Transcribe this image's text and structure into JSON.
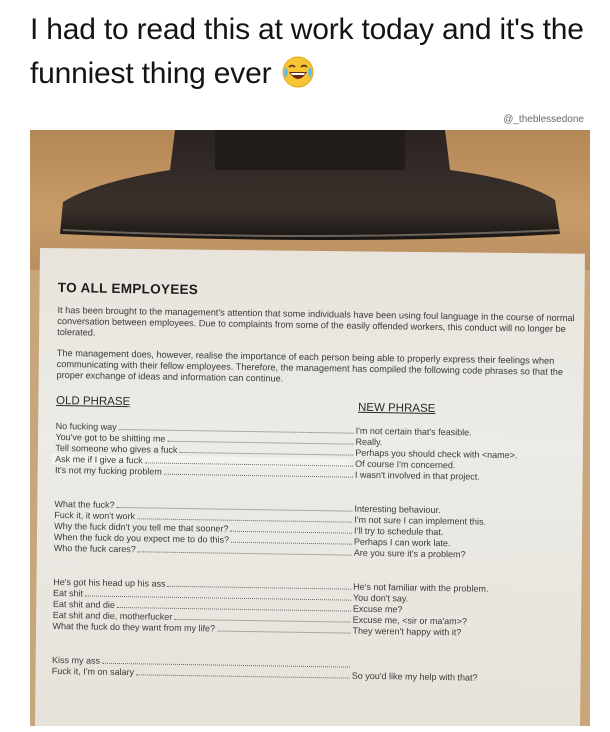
{
  "caption": {
    "text": "I had to read this at work today and it's the funniest thing ever",
    "emoji_icon": "laughing-emoji-icon"
  },
  "watermark": "@_theblessedone",
  "document": {
    "heading": "TO ALL EMPLOYEES",
    "para1": "It has been brought to the management's attention that some individuals have been using foul language in the course of normal conversation between employees. Due to complaints from some of the easily offended workers, this conduct will no longer be tolerated.",
    "para2": "The management does, however, realise the importance of each person being able to properly express their feelings when communicating with their fellow employees. Therefore, the management has compiled the following code phrases so that the proper exchange of ideas and information can continue.",
    "old_header": "OLD PHRASE",
    "new_header": "NEW PHRASE",
    "groups": [
      [
        {
          "old": "No fucking way",
          "new": "I'm not certain that's feasible."
        },
        {
          "old": "You've got to be shitting me",
          "new": "Really."
        },
        {
          "old": "Tell someone who gives a fuck",
          "new": "Perhaps you should check with <name>."
        },
        {
          "old": "Ask me if I give a fuck",
          "new": "Of course I'm concerned."
        },
        {
          "old": "It's not my fucking problem",
          "new": "I wasn't involved in that project."
        }
      ],
      [
        {
          "old": "What the fuck?",
          "new": "Interesting behaviour."
        },
        {
          "old": "Fuck it, it won't work",
          "new": "I'm not sure I can implement this."
        },
        {
          "old": "Why the fuck didn't you tell me that sooner?",
          "new": "I'll try to schedule that."
        },
        {
          "old": "When the fuck do you expect me to do this?",
          "new": "Perhaps I can work late."
        },
        {
          "old": "Who the fuck cares?",
          "new": "Are you sure it's a problem?"
        }
      ],
      [
        {
          "old": "He's got his head up his ass",
          "new": "He's not familiar with the problem."
        },
        {
          "old": "Eat shit",
          "new": "You don't say."
        },
        {
          "old": "Eat shit and die",
          "new": "Excuse me?"
        },
        {
          "old": "Eat shit and die, motherfucker",
          "new": "Excuse me, <sir or ma'am>?"
        },
        {
          "old": "What the fuck do they want from my life?",
          "new": "They weren't happy with it?"
        }
      ],
      [
        {
          "old": "Kiss my ass",
          "new": ""
        },
        {
          "old": "Fuck it, I'm on salary",
          "new": "So you'd like my help with that?"
        }
      ]
    ]
  }
}
